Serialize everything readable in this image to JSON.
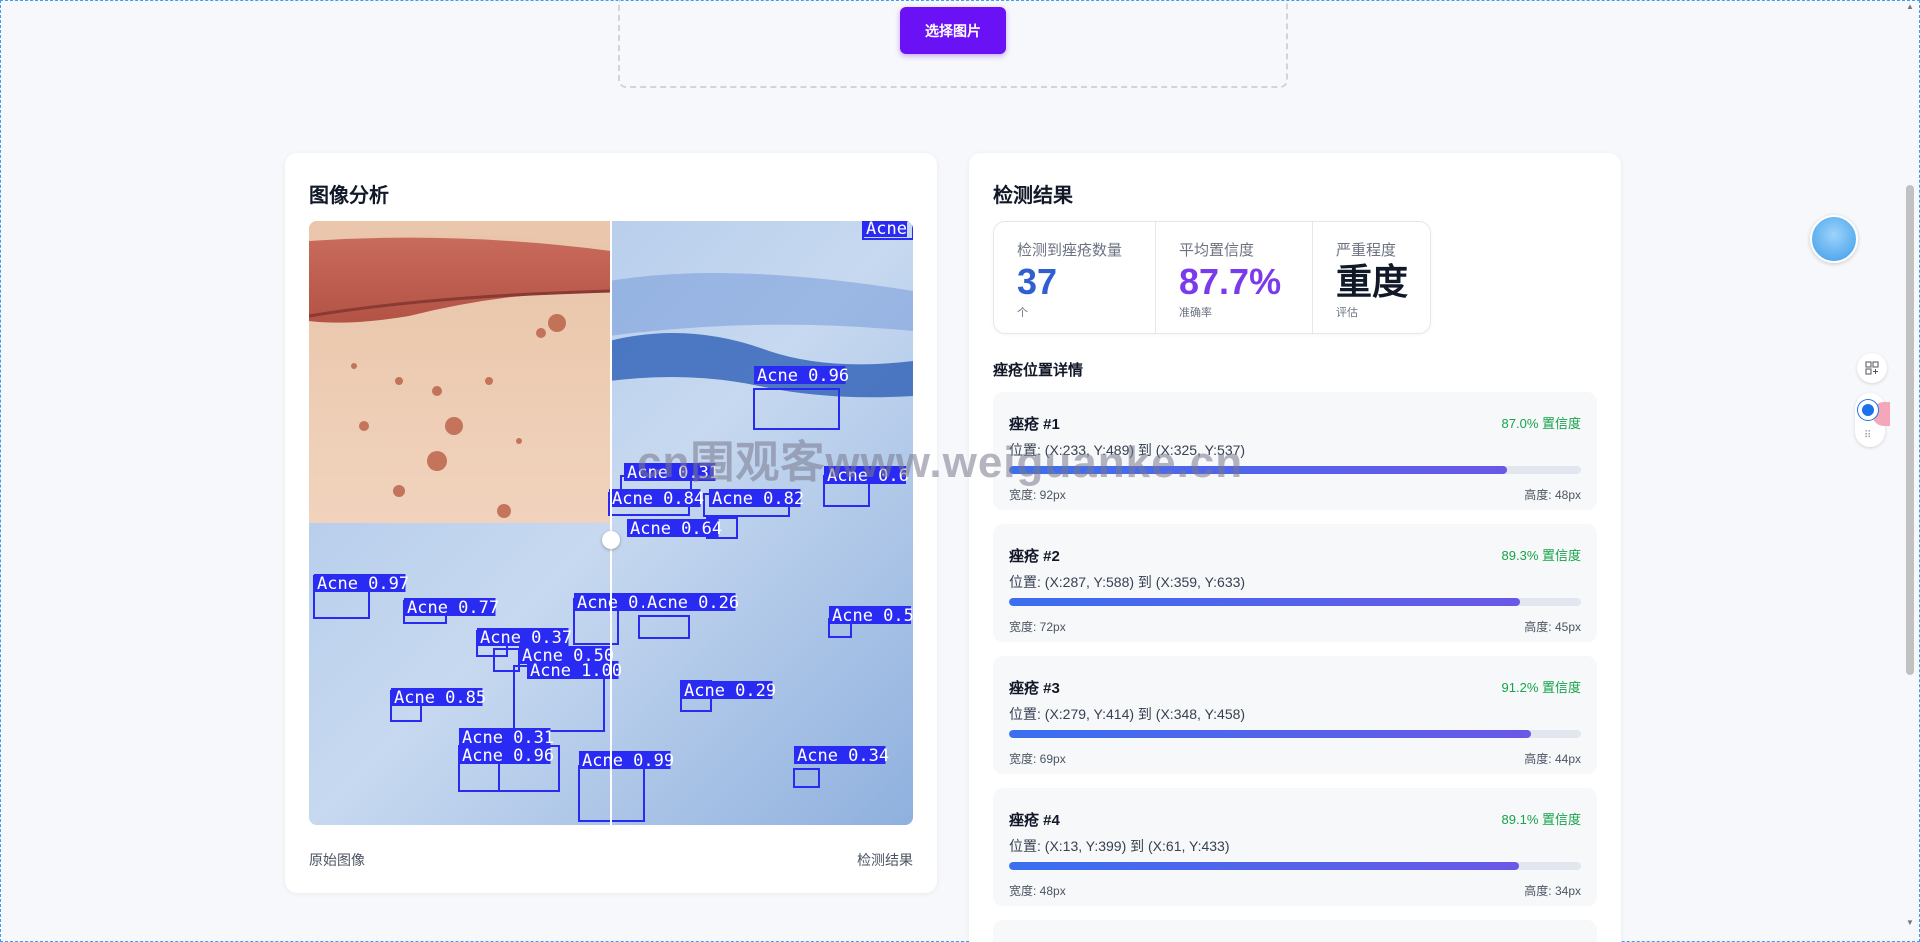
{
  "upload": {
    "button_label": "选择图片"
  },
  "analysis": {
    "title": "图像分析",
    "caption_left": "原始图像",
    "caption_right": "检测结果",
    "detections": [
      {
        "label": "Acne 0.96"
      },
      {
        "label": "Acne 0.31"
      },
      {
        "label": "Acne 0.84"
      },
      {
        "label": "Acne 0.82"
      },
      {
        "label": "Acne 0.64"
      },
      {
        "label": "Acne 0.97"
      },
      {
        "label": "Acne 0.77"
      },
      {
        "label": "Acne 0.98"
      },
      {
        "label": "Acne 0.26"
      },
      {
        "label": "Acne 0.37"
      },
      {
        "label": "Acne 0.50"
      },
      {
        "label": "Acne 1.00"
      },
      {
        "label": "Acne 0.85"
      },
      {
        "label": "Acne 0.29"
      },
      {
        "label": "Acne 0.31"
      },
      {
        "label": "Acne 0.96"
      },
      {
        "label": "Acne 0.99"
      },
      {
        "label": "Acne 0.34"
      },
      {
        "label": "Acne 0.5"
      },
      {
        "label": "Acne 0.6"
      },
      {
        "label": "Acne"
      }
    ]
  },
  "results": {
    "title": "检测结果",
    "stats": {
      "count_label": "检测到痤疮数量",
      "count_value": "37",
      "count_unit": "个",
      "confidence_label": "平均置信度",
      "confidence_value": "87.7%",
      "confidence_sub": "准确率",
      "severity_label": "严重程度",
      "severity_value": "重度",
      "severity_sub": "评估"
    },
    "details_title": "痤疮位置详情",
    "items": [
      {
        "name": "痤疮 #1",
        "confidence": "87.0% 置信度",
        "confidence_value": 0.87,
        "position": "位置: (X:233, Y:489) 到 (X:325, Y:537)",
        "width": "宽度: 92px",
        "height": "高度: 48px"
      },
      {
        "name": "痤疮 #2",
        "confidence": "89.3% 置信度",
        "confidence_value": 0.893,
        "position": "位置: (X:287, Y:588) 到 (X:359, Y:633)",
        "width": "宽度: 72px",
        "height": "高度: 45px"
      },
      {
        "name": "痤疮 #3",
        "confidence": "91.2% 置信度",
        "confidence_value": 0.912,
        "position": "位置: (X:279, Y:414) 到 (X:348, Y:458)",
        "width": "宽度: 69px",
        "height": "高度: 44px"
      },
      {
        "name": "痤疮 #4",
        "confidence": "89.1% 置信度",
        "confidence_value": 0.891,
        "position": "位置: (X:13, Y:399) 到 (X:61, Y:433)",
        "width": "宽度: 48px",
        "height": "高度: 34px"
      }
    ]
  },
  "watermark": "cn围观客www.weiguanke.cn",
  "colors": {
    "primary_button": "#6a11f5",
    "count_blue": "#2f5fd0",
    "confidence_purple": "#7c3aed",
    "confidence_green": "#16a34a",
    "detection_box": "#2a2bf2"
  }
}
